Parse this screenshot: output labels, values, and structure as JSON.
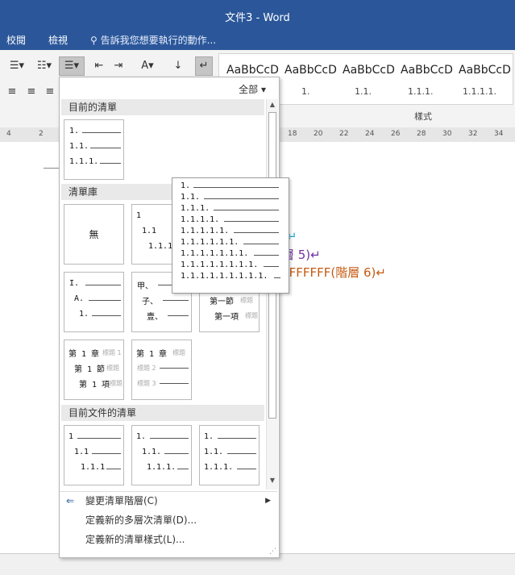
{
  "window": {
    "title": "文件3 - Word",
    "title_bg": "#2b579a"
  },
  "tabs": [
    {
      "label": "校閱"
    },
    {
      "label": "檢視"
    }
  ],
  "tellme": {
    "icon": "lightbulb-icon",
    "text": "告訴我您想要執行的動作..."
  },
  "styles": {
    "group_label": "樣式",
    "items": [
      {
        "sample": "AaBbCcD",
        "name": "",
        "color": "#e03a3a"
      },
      {
        "sample": "AaBbCcD",
        "name": "1.",
        "color": "#2e74b5"
      },
      {
        "sample": "AaBbCcD",
        "name": "1.1.",
        "color": "#4a8a3a"
      },
      {
        "sample": "AaBbCcD",
        "name": "1.1.1.",
        "color": "#1aa8d6"
      },
      {
        "sample": "AaBbCcD",
        "name": "1.1.1.1.",
        "color": "#7030a0"
      }
    ]
  },
  "ruler": {
    "ticks": [
      "4",
      "2",
      "18",
      "20",
      "22",
      "24",
      "26",
      "28",
      "30",
      "32",
      "34"
    ]
  },
  "document": {
    "lines": [
      {
        "text": ")↵",
        "color": "#1aa8d6"
      },
      {
        "text": "層 5)↵",
        "color": "#7030a0"
      },
      {
        "text": "FFFFFFF(階層 6)↵",
        "color": "#c55a11"
      }
    ]
  },
  "gallery": {
    "all_label": "全部",
    "sections": {
      "current": "目前的清單",
      "library": "清單庫",
      "document": "目前文件的清單"
    },
    "current_thumb": [
      "1.",
      "1.1.",
      "1.1.1."
    ],
    "library_thumbs": [
      {
        "none_label": "無"
      },
      {
        "lines": [
          "1",
          "1.1",
          "1.1.1"
        ]
      },
      {
        "lines": [
          "I.",
          "A.",
          "1."
        ]
      },
      {
        "lines": [
          "甲、",
          "子、",
          "壹、"
        ]
      },
      {
        "lines": [
          "第一節",
          "第一項"
        ],
        "ph": [
          "標題",
          "標題"
        ]
      },
      {
        "lines": [
          "第 1 章",
          "第 1 節",
          "第 1 項"
        ],
        "ph": [
          "標題 1",
          "標題",
          "標題"
        ]
      },
      {
        "lines": [
          "第 1 章"
        ],
        "ph": [
          "標題",
          "標題 2",
          "標題 3"
        ]
      }
    ],
    "doc_thumbs": [
      {
        "lines": [
          "1",
          "1.1",
          "1.1.1"
        ]
      },
      {
        "lines": [
          "1.",
          "1.1.",
          "1.1.1."
        ]
      },
      {
        "lines": [
          "1.",
          "1.1.",
          "1.1.1."
        ]
      }
    ],
    "preview": [
      "1.",
      "1.1.",
      "1.1.1.",
      "1.1.1.1.",
      "1.1.1.1.1.",
      "1.1.1.1.1.1.",
      "1.1.1.1.1.1.1.",
      "1.1.1.1.1.1.1.1.",
      "1.1.1.1.1.1.1.1.1."
    ]
  },
  "menu": [
    {
      "label": "變更清單階層(C)",
      "icon": "indent-arrow-icon",
      "has_submenu": true
    },
    {
      "label": "定義新的多層次清單(D)...",
      "icon": "",
      "has_submenu": false
    },
    {
      "label": "定義新的清單樣式(L)...",
      "icon": "",
      "has_submenu": false
    }
  ]
}
